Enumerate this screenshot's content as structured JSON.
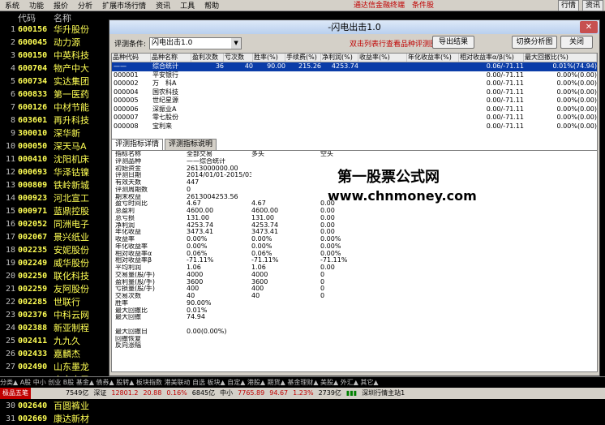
{
  "menu": {
    "items": [
      "系统",
      "功能",
      "报价",
      "分析",
      "扩展市场行情",
      "资讯",
      "工具",
      "帮助"
    ],
    "center": "通达信金融终端　条件股",
    "right": [
      "行情",
      "资讯"
    ]
  },
  "stocklist": {
    "head": {
      "code": "代码",
      "name": "名称"
    },
    "rows": [
      {
        "n": "1",
        "code": "600156",
        "name": "华升股份"
      },
      {
        "n": "2",
        "code": "600045",
        "name": "动力源"
      },
      {
        "n": "3",
        "code": "600150",
        "name": "中英科技"
      },
      {
        "n": "4",
        "code": "600704",
        "name": "物产中大"
      },
      {
        "n": "5",
        "code": "600734",
        "name": "实达集团"
      },
      {
        "n": "6",
        "code": "600833",
        "name": "第一医药"
      },
      {
        "n": "7",
        "code": "600126",
        "name": "中材节能"
      },
      {
        "n": "8",
        "code": "603601",
        "name": "再升科技"
      },
      {
        "n": "9",
        "code": "300010",
        "name": "深华新"
      },
      {
        "n": "10",
        "code": "000050",
        "name": "深天马A"
      },
      {
        "n": "11",
        "code": "000410",
        "name": "沈阳机床"
      },
      {
        "n": "12",
        "code": "000693",
        "name": "华泽钴镍"
      },
      {
        "n": "13",
        "code": "000809",
        "name": "铁岭新城"
      },
      {
        "n": "14",
        "code": "000923",
        "name": "河北宣工"
      },
      {
        "n": "15",
        "code": "000971",
        "name": "蓝鼎控股"
      },
      {
        "n": "16",
        "code": "002052",
        "name": "同洲电子"
      },
      {
        "n": "17",
        "code": "002067",
        "name": "景兴纸业"
      },
      {
        "n": "18",
        "code": "002235",
        "name": "安妮股份"
      },
      {
        "n": "19",
        "code": "002249",
        "name": "威华股份"
      },
      {
        "n": "20",
        "code": "002250",
        "name": "联化科技"
      },
      {
        "n": "21",
        "code": "002259",
        "name": "友阿股份"
      },
      {
        "n": "22",
        "code": "002285",
        "name": "世联行"
      },
      {
        "n": "23",
        "code": "002376",
        "name": "中科云网"
      },
      {
        "n": "24",
        "code": "002388",
        "name": "新亚制程"
      },
      {
        "n": "25",
        "code": "002411",
        "name": "九九久"
      },
      {
        "n": "26",
        "code": "002433",
        "name": "嘉麟杰"
      },
      {
        "n": "27",
        "code": "002490",
        "name": "山东墨龙"
      },
      {
        "n": "28",
        "code": "002579",
        "name": "中京电子"
      },
      {
        "n": "29",
        "code": "002613",
        "name": "北玻股份"
      },
      {
        "n": "30",
        "code": "002640",
        "name": "百圆裤业"
      },
      {
        "n": "31",
        "code": "002669",
        "name": "康达新材"
      }
    ]
  },
  "dialog": {
    "title": "-闪电出击1.0",
    "close": "✕",
    "cond_label": "评测条件:",
    "cond_value": "闪电出击1.0",
    "hint": "双击列表行查看品种评测图表",
    "btn_export": "导出结果",
    "btn_chart": "切换分析图",
    "btn_close": "关闭",
    "grid": {
      "headers": [
        "品种代码",
        "品种名称",
        "盈利次数",
        "亏次数",
        "胜率(%)",
        "手续费(%)",
        "净利润(%)",
        "收益率(%)",
        "年化收益率(%)",
        "相对收益率α/β(%)",
        "最大回撤比(%)"
      ],
      "rows": [
        [
          "——",
          "综合统计",
          "36",
          "40",
          "90.00",
          "215.26",
          "4253.74",
          "",
          "",
          "0.06/-71.11",
          "0.01%(74.94)"
        ],
        [
          "000001",
          "平安银行",
          "",
          "",
          "",
          "",
          "",
          "",
          "",
          "0.00/-71.11",
          "0.00%(0.00)"
        ],
        [
          "000002",
          "万　科A",
          "",
          "",
          "",
          "",
          "",
          "",
          "",
          "0.00/-71.11",
          "0.00%(0.00)"
        ],
        [
          "000004",
          "国农科技",
          "",
          "",
          "",
          "",
          "",
          "",
          "",
          "0.00/-71.11",
          "0.00%(0.00)"
        ],
        [
          "000005",
          "世纪星源",
          "",
          "",
          "",
          "",
          "",
          "",
          "",
          "0.00/-71.11",
          "0.00%(0.00)"
        ],
        [
          "000006",
          "深振业A",
          "",
          "",
          "",
          "",
          "",
          "",
          "",
          "0.00/-71.11",
          "0.00%(0.00)"
        ],
        [
          "000007",
          "零七股份",
          "",
          "",
          "",
          "",
          "",
          "",
          "",
          "0.00/-71.11",
          "0.00%(0.00)"
        ],
        [
          "000008",
          "宝利来",
          "",
          "",
          "",
          "",
          "",
          "",
          "",
          "0.00/-71.11",
          "0.00%(0.00)"
        ]
      ]
    },
    "tabs": [
      "评测指标详情",
      "评测指标说明"
    ],
    "detail": {
      "head": [
        "指标名称",
        "全部交易",
        "多头",
        "空头"
      ],
      "rows": [
        [
          "评测品种",
          "——综合统计",
          "",
          ""
        ],
        [
          "初始资金",
          "2613000000.00",
          "",
          ""
        ],
        [
          "评测日期",
          "2014/01/01-2015/03/24",
          "",
          ""
        ],
        [
          "有效天数",
          "447",
          "",
          ""
        ],
        [
          "评测周期数",
          "0",
          "",
          ""
        ],
        [
          "期末权益",
          "2613004253.56",
          "",
          ""
        ],
        [
          "盈亏时间比",
          "4.67",
          "4.67",
          "0.00"
        ],
        [
          "总盈利",
          "4600.00",
          "4600.00",
          "0.00"
        ],
        [
          "总亏损",
          "131.00",
          "131.00",
          "0.00"
        ],
        [
          "净利润",
          "4253.74",
          "4253.74",
          "0.00"
        ],
        [
          "年化收益",
          "3473.41",
          "3473.41",
          "0.00"
        ],
        [
          "收益率",
          "0.00%",
          "0.00%",
          "0.00%"
        ],
        [
          "年化收益率",
          "0.00%",
          "0.00%",
          "0.00%"
        ],
        [
          "相对收益率α",
          "0.06%",
          "0.06%",
          "0.00%"
        ],
        [
          "相对收益率β",
          "-71.11%",
          "-71.11%",
          "-71.11%"
        ],
        [
          "平均利润",
          "1.06",
          "1.06",
          "0.00"
        ],
        [
          "交易量(股/手)",
          "4000",
          "4000",
          "0"
        ],
        [
          "盈利量(股/手)",
          "3600",
          "3600",
          "0"
        ],
        [
          "亏损量(股/手)",
          "400",
          "400",
          "0"
        ],
        [
          "交易次数",
          "40",
          "40",
          "0"
        ],
        [
          "胜率",
          "90.00%",
          "",
          ""
        ],
        [
          "最大回撤比",
          "0.01%",
          "",
          ""
        ],
        [
          "最大回撤",
          "74.94",
          "",
          ""
        ],
        [
          "",
          "",
          "",
          ""
        ],
        [
          "最大回撤日",
          "0.00(0.00%)",
          "",
          ""
        ],
        [
          "回撤恢复",
          "",
          "",
          ""
        ],
        [
          "反向涨幅",
          "",
          "",
          ""
        ]
      ]
    },
    "wm1": "第一股票公式网",
    "wm2": "www.chnmoney.com"
  },
  "tabbar": "分类▲ A股 中小 创业 B股 基金▲ 债券▲ 股转▲ 板块指数 港美联动 自选 板块▲ 自定▲ 港股▲ 期货▲ 基金理财▲ 美股▲ 外汇▲ 其它▲",
  "status": {
    "logo": "极品五笔",
    "s1": "7549亿",
    "s2": "深证",
    "s2v": "12801.2",
    "s2c": "20.88",
    "s2p": "0.16%",
    "s3": "6845亿",
    "s4": "中小",
    "s4v": "7765.89",
    "s4c": "94.67",
    "s4p": "1.23%",
    "s5": "2739亿",
    "s6": "深圳行情主站1"
  }
}
